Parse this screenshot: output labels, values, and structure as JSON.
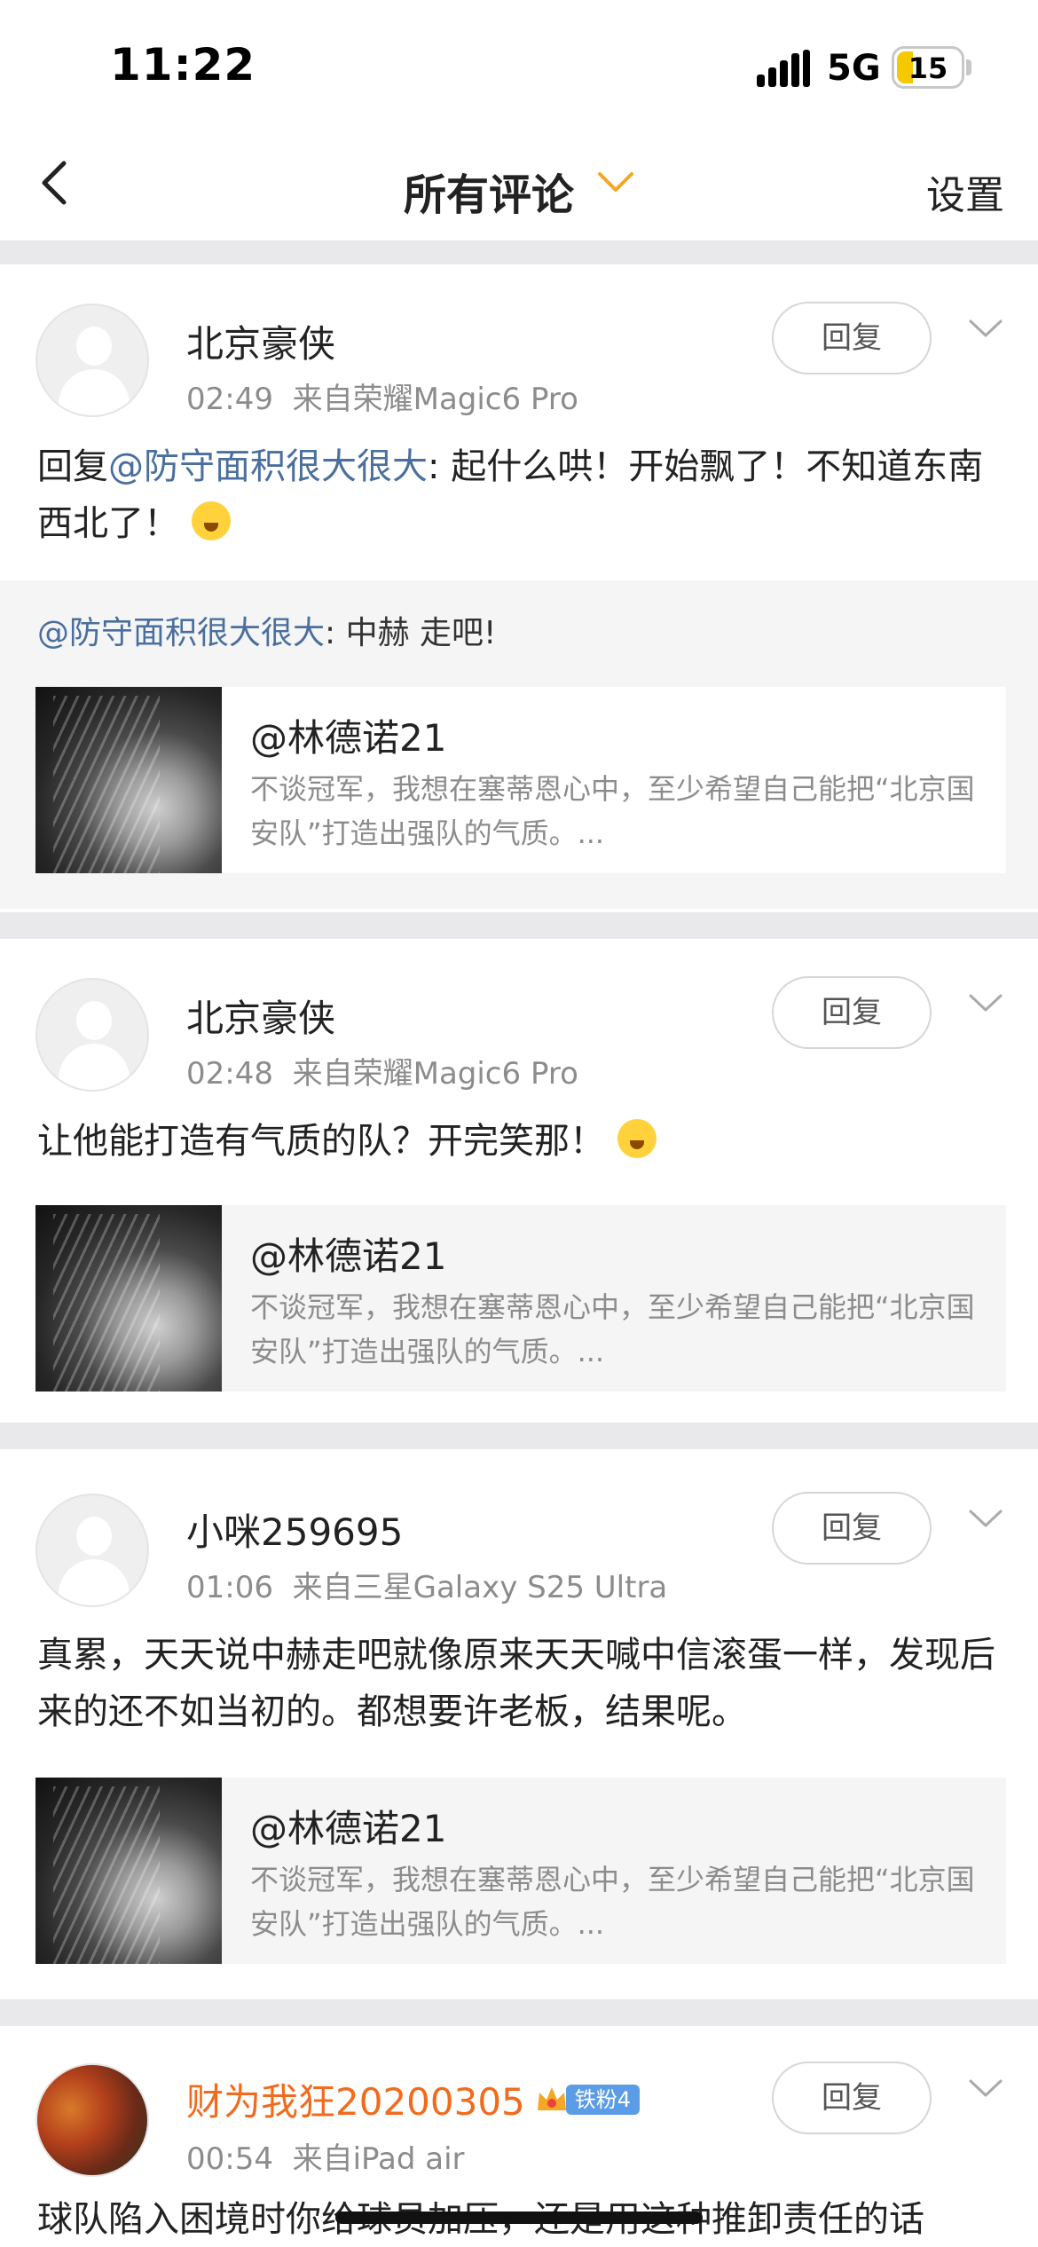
{
  "status_bar": {
    "time": "11:22",
    "network": "5G",
    "battery": "15"
  },
  "nav": {
    "title": "所有评论",
    "settings": "设置"
  },
  "comments": [
    {
      "username": "北京豪侠",
      "time": "02:49",
      "source": "来自荣耀Magic6 Pro",
      "reply_label": "回复",
      "text_prefix": "回复",
      "text_mention": "@防守面积很大很大",
      "text_body": ": 起什么哄！开始飘了！不知道东南西北了！",
      "quote_mention": "@防守面积很大很大",
      "quote_body": ": 中赫 走吧!",
      "preview": {
        "author": "@林德诺21",
        "excerpt": "不谈冠军，我想在塞蒂恩心中，至少希望自己能把“北京国安队”打造出强队的气质。..."
      }
    },
    {
      "username": "北京豪侠",
      "time": "02:48",
      "source": "来自荣耀Magic6 Pro",
      "reply_label": "回复",
      "text_body": "让他能打造有气质的队？开完笑那！",
      "preview": {
        "author": "@林德诺21",
        "excerpt": "不谈冠军，我想在塞蒂恩心中，至少希望自己能把“北京国安队”打造出强队的气质。..."
      }
    },
    {
      "username": "小咪259695",
      "time": "01:06",
      "source": "来自三星Galaxy S25 Ultra",
      "reply_label": "回复",
      "text_body": "真累，天天说中赫走吧就像原来天天喊中信滚蛋一样，发现后来的还不如当初的。都想要许老板，结果呢。",
      "preview": {
        "author": "@林德诺21",
        "excerpt": "不谈冠军，我想在塞蒂恩心中，至少希望自己能把“北京国安队”打造出强队的气质。..."
      }
    },
    {
      "username": "财为我狂20200305",
      "fan_tag": "铁粉4",
      "time": "00:54",
      "source": "来自iPad air",
      "reply_label": "回复",
      "text_body": "球队陷入困境时你给球员加压，还是用这种推卸责任的话"
    }
  ]
}
